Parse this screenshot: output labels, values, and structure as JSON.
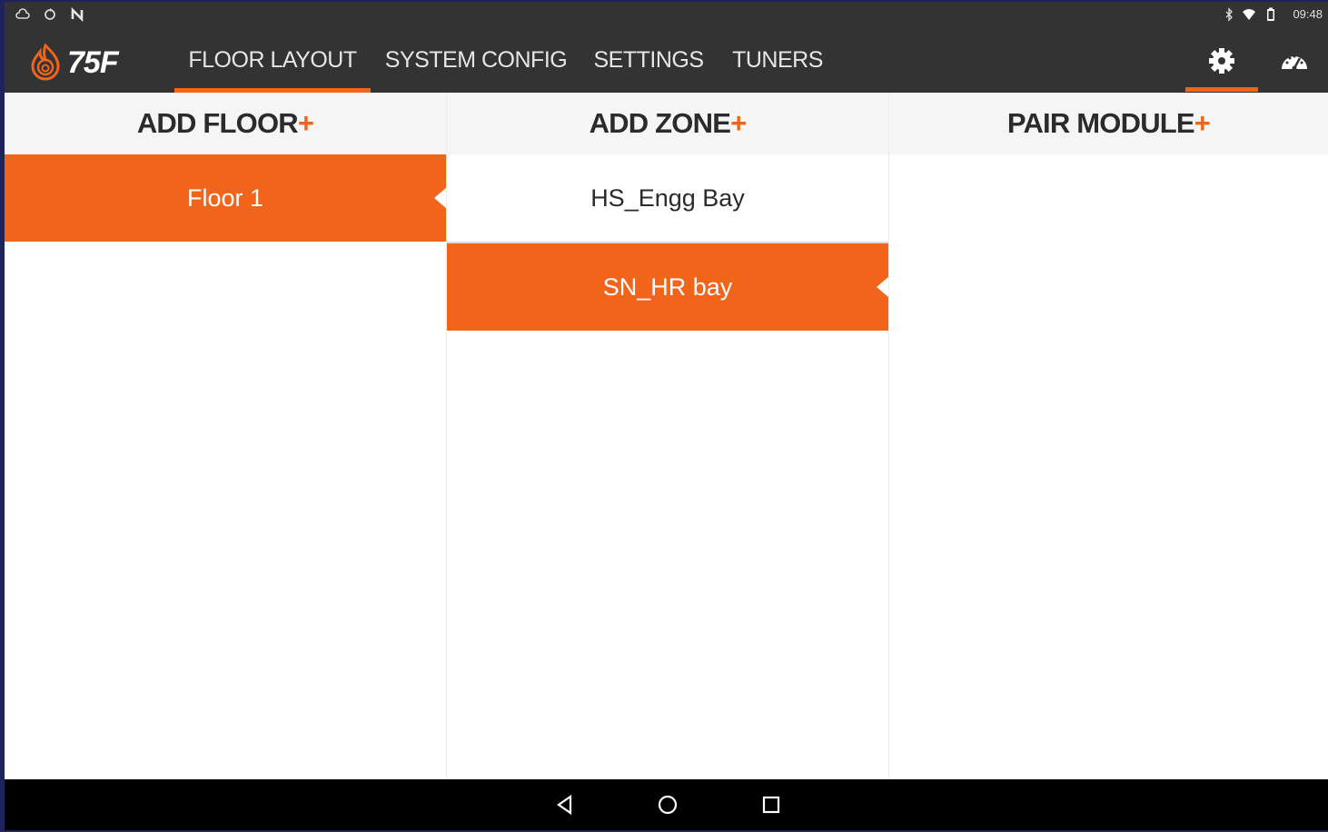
{
  "status_bar": {
    "time": "09:48",
    "left_icons": [
      "cloud-icon",
      "sync-icon",
      "nfc-icon"
    ],
    "right_icons": [
      "bluetooth-icon",
      "wifi-icon",
      "battery-icon"
    ]
  },
  "app_bar": {
    "logo_text": "75F",
    "tabs": [
      {
        "label": "FLOOR LAYOUT",
        "active": true
      },
      {
        "label": "SYSTEM CONFIG",
        "active": false
      },
      {
        "label": "SETTINGS",
        "active": false
      },
      {
        "label": "TUNERS",
        "active": false
      }
    ],
    "actions": [
      "gear-icon",
      "dashboard-icon"
    ]
  },
  "columns": {
    "floors": {
      "header": "ADD FLOOR",
      "plus": "+",
      "items": [
        {
          "label": "Floor 1",
          "selected": true
        }
      ]
    },
    "zones": {
      "header": "ADD ZONE",
      "plus": "+",
      "items": [
        {
          "label": "HS_Engg Bay",
          "selected": false
        },
        {
          "label": "SN_HR bay",
          "selected": true
        }
      ]
    },
    "modules": {
      "header": "PAIR MODULE",
      "plus": "+",
      "items": []
    }
  },
  "colors": {
    "accent": "#f26419",
    "bar": "#333333",
    "header_bg": "#f5f5f5"
  },
  "nav_bar": {
    "buttons": [
      "back-icon",
      "home-icon",
      "recents-icon"
    ]
  }
}
